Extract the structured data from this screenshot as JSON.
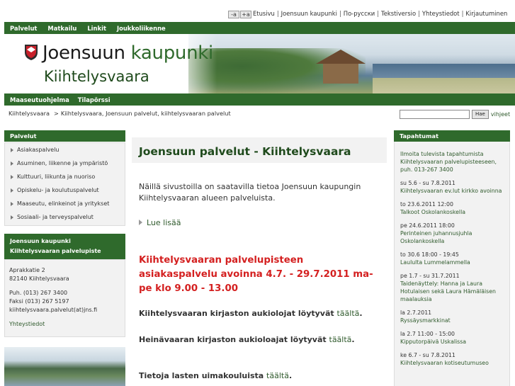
{
  "utility": {
    "font_smaller": "-a",
    "font_larger": "+a",
    "links": [
      "Etusivu",
      "Joensuun kaupunki",
      "По-русски",
      "Tekstiversio",
      "Yhteystiedot",
      "Kirjautuminen"
    ]
  },
  "nav": {
    "items": [
      "Palvelut",
      "Matkailu",
      "Linkit",
      "Joukkoliikenne"
    ]
  },
  "banner": {
    "logo_word1": "Joensuun",
    "logo_word2": "kaupunki",
    "logo_sub": "Kiihtelysvaara"
  },
  "subnav": {
    "items": [
      "Maaseutuohjelma",
      "Tilapörssi"
    ]
  },
  "breadcrumb": {
    "home": "Kiihtelysvaara",
    "arrow": ">",
    "current": "Kiihtelysvaara, Joensuun palvelut, kiihtelysvaaran palvelut"
  },
  "search": {
    "button": "Hae",
    "link": "vihjeet"
  },
  "left": {
    "services_title": "Palvelut",
    "services": [
      "Asiakaspalvelu",
      "Asuminen, liikenne ja ympäristö",
      "Kulttuuri, liikunta ja nuoriso",
      "Opiskelu- ja koulutuspalvelut",
      "Maaseutu, elinkeinot ja yritykset",
      "Sosiaali- ja terveyspalvelut"
    ],
    "office_title_1": "Joensuun kaupunki",
    "office_title_2": "Kiihtelysvaaran palvelupiste",
    "address_1": "Aprakkatie 2",
    "address_2": "82140 Kiihtelysvaara",
    "phone": "Puh. (013) 267 3400",
    "fax": "Faksi (013) 267 5197",
    "email": "kiihtelysvaara.palvelut(at)jns.fi",
    "contacts_link": "Yhteystiedot"
  },
  "content": {
    "title": "Joensuun palvelut - Kiihtelysvaara",
    "intro": "Näillä sivustoilla on saatavilla tietoa Joensuun kaupungin Kiihtelysvaaran alueen palveluista.",
    "more": "Lue lisää",
    "notice": "Kiihtelysvaaran palvelupisteen asiakaspalvelu avoinna 4.7. - 29.7.2011 ma-pe klo 9.00 - 13.00",
    "p1_text": "Kiihtelysvaaran kirjaston aukiolojat löytyvät",
    "p1_link": "täältä",
    "p2_text": "Heinävaaran kirjaston aukioloajat löytyvät",
    "p2_link": "täältä",
    "p3_text": "Tietoja lasten uimakouluista",
    "p3_link": "täältä",
    "period": "."
  },
  "events": {
    "title": "Tapahtumat",
    "intro": "Ilmoita tulevista tapahtumista Kiihtelysvaaran palvelupisteeseen, puh. 013-267 3400",
    "items": [
      {
        "date": "su 5.6 - su 7.8.2011",
        "title": "Kiihtelysvaaran ev.lut kirkko avoinna"
      },
      {
        "date": "to 23.6.2011 12:00",
        "title": "Talkoot Oskolankoskella"
      },
      {
        "date": "pe 24.6.2011 18:00",
        "title": "Perinteinen juhannusjuhla Oskolankoskella"
      },
      {
        "date": "to 30.6 18:00 - 19:45",
        "title": "Laululta Lummelammella"
      },
      {
        "date": "pe 1.7 - su 31.7.2011",
        "title": "Taidenäyttely: Hanna ja Laura Hotulaisen sekä Laura Hämäläisen maalauksia"
      },
      {
        "date": "la 2.7.2011",
        "title": "Ryssäysmarkkinat"
      },
      {
        "date": "la 2.7 11:00 - 15:00",
        "title": "Kipputorpäivä Uskalissa"
      },
      {
        "date": "ke 6.7 - su 7.8.2011",
        "title": "Kiihtelysvaaran kotiseutumuseo"
      }
    ]
  },
  "colors": {
    "green": "#2f6a2c",
    "notice_red": "#d42020",
    "link_green": "#2f5a2c"
  }
}
